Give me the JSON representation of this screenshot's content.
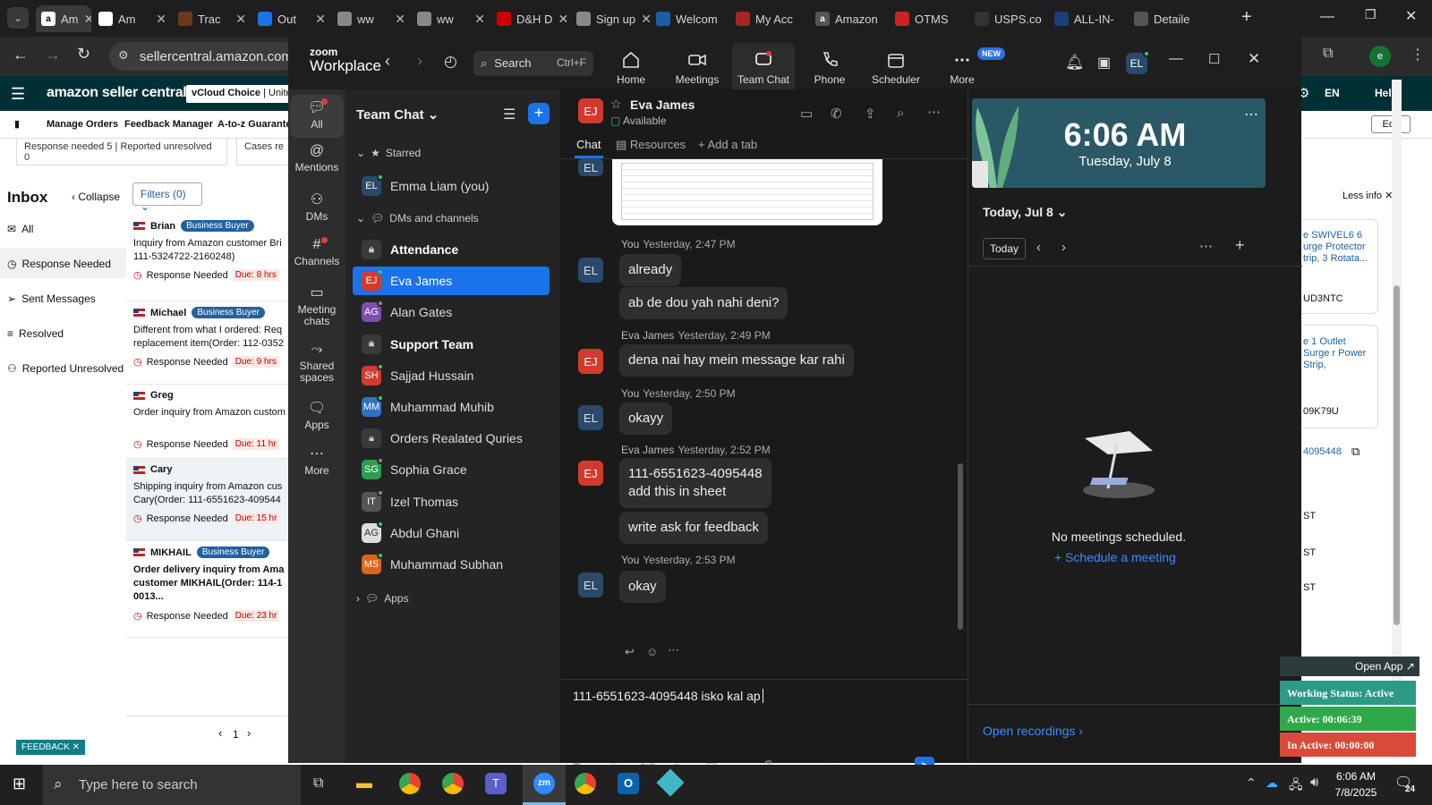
{
  "browser": {
    "tabs": [
      {
        "label": "Am",
        "icon": "amazon-icon",
        "color": "#fff"
      },
      {
        "label": "Am",
        "icon": "amazon-icon",
        "color": "#fff"
      },
      {
        "label": "Trac",
        "icon": "ups-icon",
        "color": "#6b3a1c"
      },
      {
        "label": "Out",
        "icon": "outlook-icon",
        "color": "#1a73e8"
      },
      {
        "label": "ww",
        "icon": "globe-icon",
        "color": "#888"
      },
      {
        "label": "ww",
        "icon": "globe-icon",
        "color": "#888"
      },
      {
        "label": "D&H D",
        "icon": "dh-icon",
        "color": "#c00"
      },
      {
        "label": "Sign up",
        "icon": "globe-icon",
        "color": "#888"
      },
      {
        "label": "Welcom",
        "icon": "ec-icon",
        "color": "#1b5fa8"
      },
      {
        "label": "My Acc",
        "icon": "account-icon",
        "color": "#a22"
      },
      {
        "label": "Amazon",
        "icon": "amazon-icon",
        "color": "#555"
      },
      {
        "label": "OTMS",
        "icon": "otms-icon",
        "color": "#c22"
      },
      {
        "label": "USPS.co",
        "icon": "usps-icon",
        "color": "#333"
      },
      {
        "label": "ALL-IN-",
        "icon": "seventeen-icon",
        "color": "#1a3f7a"
      },
      {
        "label": "Detaile",
        "icon": "detail-icon",
        "color": "#555"
      }
    ],
    "url": "sellercentral.amazon.com/r"
  },
  "seller": {
    "logo": "amazon seller central",
    "store": "vCloud Choice",
    "store_extra": "Unite",
    "lang": "EN",
    "help": "Help",
    "nav": [
      "Manage Orders",
      "Feedback Manager",
      "A-to-z Guarantee"
    ],
    "edit": "Edit",
    "summary": "Response needed 5 | Reported unresolved 0",
    "cases": "Cases re",
    "inbox": "Inbox",
    "collapse": "Collapse",
    "filters": "Filters (0)",
    "left_items": [
      "All",
      "Response Needed",
      "Sent Messages",
      "Resolved",
      "Reported Unresolved"
    ],
    "messages": [
      {
        "name": "Brian",
        "badge": "Business Buyer",
        "text": "Inquiry from Amazon customer Bri 111-5324722-2160248)",
        "status": "Response Needed",
        "due": "Due: 8 hrs"
      },
      {
        "name": "Michael",
        "badge": "Business Buyer",
        "text": "Different from what I ordered: Req replacement item(Order: 112-0352",
        "status": "Response Needed",
        "due": "Due: 9 hrs"
      },
      {
        "name": "Greg",
        "badge": "",
        "text": "Order inquiry from Amazon custom",
        "status": "Response Needed",
        "due": "Due: 11 hr"
      },
      {
        "name": "Cary",
        "badge": "",
        "text": "Shipping inquiry from Amazon cus Cary(Order: 111-6551623-409544",
        "status": "Response Needed",
        "due": "Due: 15 hr"
      },
      {
        "name": "MIKHAIL",
        "badge": "Business Buyer",
        "text": "Order delivery inquiry from Ama customer MIKHAIL(Order: 114-1 0013...",
        "status": "Response Needed",
        "due": "Due: 23 hr"
      }
    ],
    "page": "1",
    "feedback": "FEEDBACK",
    "less_info": "Less info",
    "right_items": [
      "e SWIVEL6 6 urge Protector trip, 3 Rotata...",
      "UD3NTC",
      "e 1 Outlet Surge r Power Strip,",
      "09K79U",
      "4095448",
      "ST",
      "ST",
      "ST"
    ]
  },
  "zoom": {
    "brand_top": "zoom",
    "brand": "Workplace",
    "search": "Search",
    "shortcut": "Ctrl+F",
    "nav": [
      {
        "label": "Home",
        "icon": "home-icon"
      },
      {
        "label": "Meetings",
        "icon": "video-icon"
      },
      {
        "label": "Team Chat",
        "icon": "chat-icon"
      },
      {
        "label": "Phone",
        "icon": "phone-icon"
      },
      {
        "label": "Scheduler",
        "icon": "calendar-icon"
      },
      {
        "label": "More",
        "icon": "more-icon"
      }
    ],
    "new_badge": "NEW",
    "user_initials": "EL",
    "rail": [
      "All",
      "Mentions",
      "DMs",
      "Channels",
      "Meeting chats",
      "Shared spaces",
      "Apps",
      "More"
    ],
    "list_title": "Team Chat",
    "starred": "Starred",
    "self": {
      "initials": "EL",
      "name": "Emma Liam (you)"
    },
    "dms_header": "DMs and channels",
    "items": [
      {
        "name": "Attendance",
        "type": "channel",
        "bold": true
      },
      {
        "name": "Eva James",
        "initials": "EJ",
        "color": "#d13b2e",
        "status": "#2ecc71",
        "active": true
      },
      {
        "name": "Alan Gates",
        "initials": "AG",
        "color": "#7d4fb0",
        "status": "#888"
      },
      {
        "name": "Support Team",
        "type": "channel",
        "bold": true
      },
      {
        "name": "Sajjad Hussain",
        "initials": "SH",
        "color": "#d13b2e",
        "status": "#2ecc71"
      },
      {
        "name": "Muhammad Muhib",
        "initials": "MM",
        "color": "#2f72c4",
        "status": "#2ecc71"
      },
      {
        "name": "Orders Realated Quries",
        "type": "channel",
        "bold": false
      },
      {
        "name": "Sophia Grace",
        "initials": "SG",
        "color": "#2e9e4f",
        "status": "#888"
      },
      {
        "name": "Izel Thomas",
        "initials": "IT",
        "color": "#555",
        "status": "#888"
      },
      {
        "name": "Abdul Ghani",
        "initials": "AG",
        "color": "#ddd",
        "status": "#2ecc71"
      },
      {
        "name": "Muhammad Subhan",
        "initials": "MS",
        "color": "#d8661b",
        "status": "#2ecc71"
      }
    ],
    "apps": "Apps",
    "chat": {
      "contact": "Eva James",
      "contact_initials": "EJ",
      "presence": "Available",
      "tabs": [
        "Chat",
        "Resources",
        "Add a tab"
      ],
      "messages": [
        {
          "meta_name": "You",
          "meta_time": "Yesterday, 2:47 PM",
          "avatar": "EL",
          "bubbles": [
            "already",
            "ab de dou yah nahi deni?"
          ]
        },
        {
          "meta_name": "Eva James",
          "meta_time": "Yesterday, 2:49 PM",
          "avatar": "EJ",
          "bubbles": [
            "dena nai hay mein message kar rahi"
          ]
        },
        {
          "meta_name": "You",
          "meta_time": "Yesterday, 2:50 PM",
          "avatar": "EL",
          "bubbles": [
            "okayy"
          ]
        },
        {
          "meta_name": "Eva James",
          "meta_time": "Yesterday, 2:52 PM",
          "avatar": "EJ",
          "bubbles": [
            "111-6551623-4095448\nadd this in sheet",
            "write ask for feedback"
          ]
        },
        {
          "meta_name": "You",
          "meta_time": "Yesterday, 2:53 PM",
          "avatar": "EL",
          "bubbles": [
            "okay"
          ]
        }
      ],
      "top_avatar": "EL",
      "composer": "111-6551623-4095448 isko kal ap"
    },
    "calendar": {
      "time": "6:06 AM",
      "date": "Tuesday, July 8",
      "today_header": "Today, Jul 8",
      "today_btn": "Today",
      "empty": "No meetings scheduled.",
      "schedule": "Schedule a meeting",
      "recordings": "Open recordings"
    }
  },
  "widget": {
    "open_app": "Open App",
    "working": "Working Status: Active",
    "active": "Active: 00:06:39",
    "inactive": "In Active: 00:00:00"
  },
  "taskbar": {
    "search": "Type here to search",
    "time": "6:06 AM",
    "date": "7/8/2025",
    "notif": "24"
  }
}
